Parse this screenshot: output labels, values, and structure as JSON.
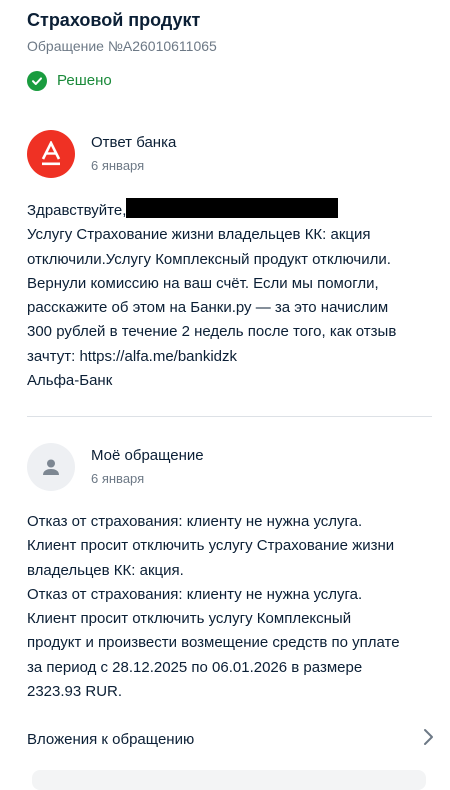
{
  "header": {
    "title": "Страховой продукт",
    "ticket_number": "Обращение №A26010611065"
  },
  "status": {
    "label": "Решено",
    "icon": "check-circle-icon",
    "color": "#1a9c3f"
  },
  "bank_reply": {
    "author": "Ответ банка",
    "date": "6 января",
    "avatar_icon": "alfa-bank-logo",
    "avatar_color": "#ef3124",
    "lines": [
      "Здравствуйте,",
      "Услугу Страхование жизни владельцев КК: акция",
      "отключили.Услугу Комплексный продукт отключили.",
      "Вернули комиссию на ваш счёт. Если мы помогли,",
      "расскажите об этом на Банки.ру — за это начислим",
      "300 рублей в течение 2 недель после того, как отзыв",
      "зачтут: https://alfa.me/bankidzk",
      "Альфа-Банк"
    ]
  },
  "user_request": {
    "author": "Моё обращение",
    "date": "6 января",
    "avatar_icon": "user-icon",
    "lines": [
      "Отказ от страхования: клиенту не нужна услуга.",
      "Клиент просит отключить услугу Страхование жизни",
      "владельцев КК: акция.",
      "Отказ от страхования: клиенту не нужна услуга.",
      "Клиент просит отключить услугу Комплексный",
      "продукт и произвести возмещение средств по уплате",
      "за период с 28.12.2025 по 06.01.2026 в размере",
      "2323.93 RUR."
    ]
  },
  "attachments": {
    "label": "Вложения к обращению",
    "icon": "chevron-right-icon"
  }
}
